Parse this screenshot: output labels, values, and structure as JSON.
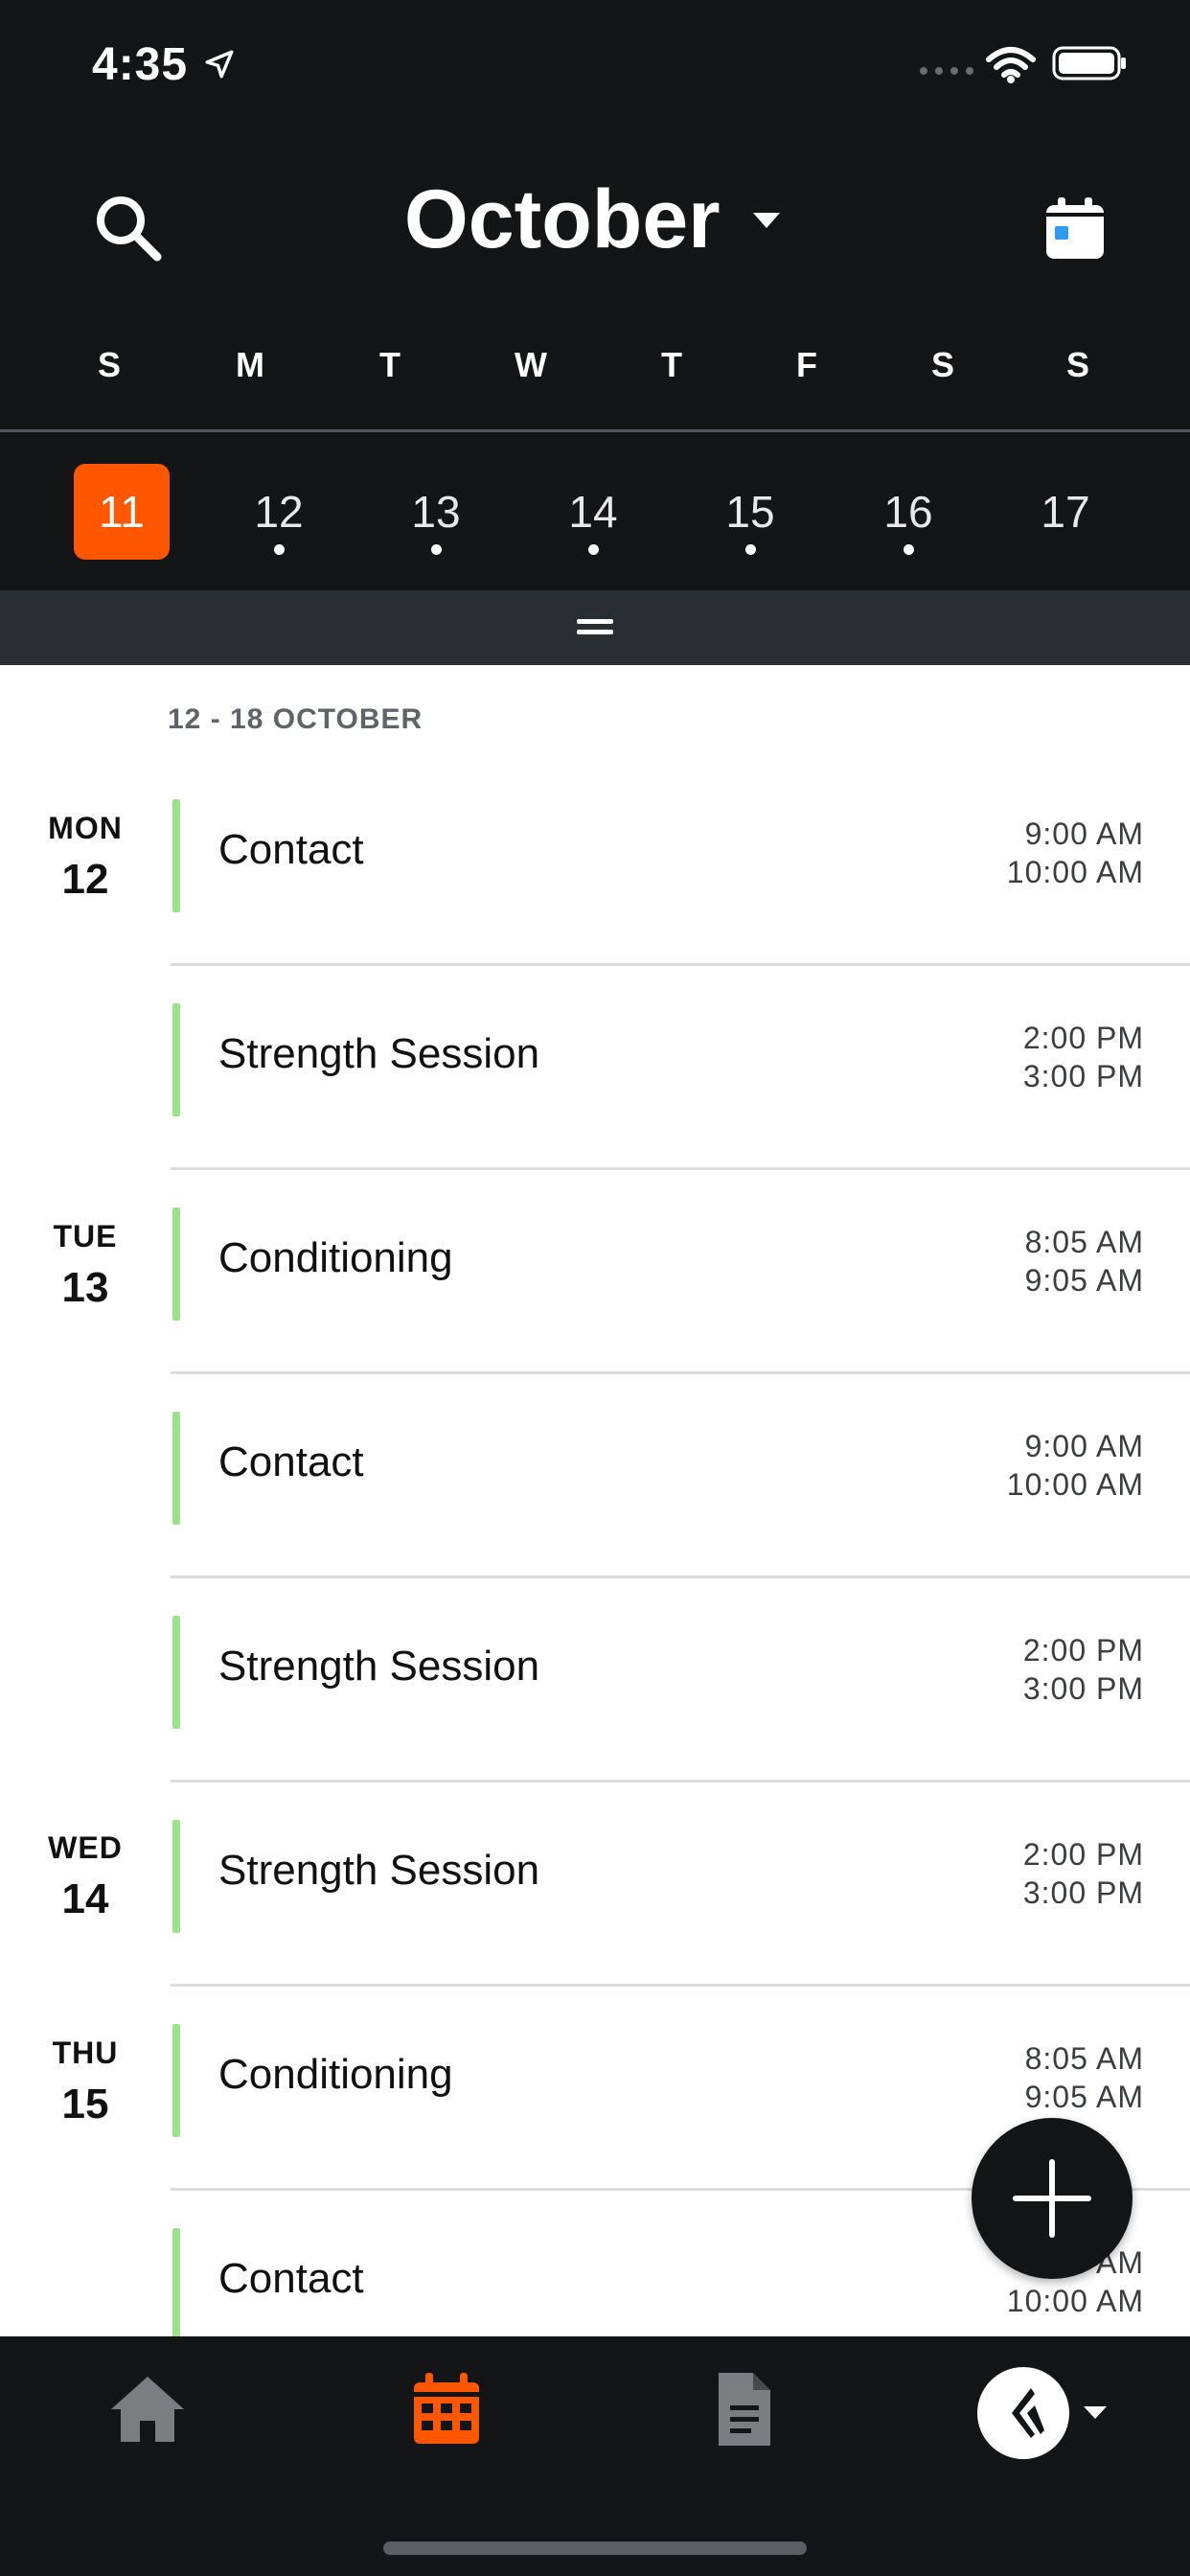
{
  "status_bar": {
    "time": "4:35"
  },
  "header": {
    "month": "October"
  },
  "weekdays": [
    "S",
    "M",
    "T",
    "W",
    "T",
    "F",
    "S",
    "S"
  ],
  "dates": [
    {
      "day": "11",
      "selected": true,
      "has_events": false
    },
    {
      "day": "12",
      "selected": false,
      "has_events": true
    },
    {
      "day": "13",
      "selected": false,
      "has_events": true
    },
    {
      "day": "14",
      "selected": false,
      "has_events": true
    },
    {
      "day": "15",
      "selected": false,
      "has_events": true
    },
    {
      "day": "16",
      "selected": false,
      "has_events": true
    },
    {
      "day": "17",
      "selected": false,
      "has_events": false
    }
  ],
  "agenda": {
    "week_range": "12 - 18 OCTOBER",
    "days": [
      {
        "name": "MON",
        "num": "12"
      },
      {
        "name": "TUE",
        "num": "13"
      },
      {
        "name": "WED",
        "num": "14"
      },
      {
        "name": "THU",
        "num": "15"
      }
    ],
    "events": [
      {
        "title": "Contact",
        "start": "9:00 AM",
        "end": "10:00 AM"
      },
      {
        "title": "Strength Session",
        "start": "2:00 PM",
        "end": "3:00 PM"
      },
      {
        "title": "Conditioning",
        "start": "8:05 AM",
        "end": "9:05 AM"
      },
      {
        "title": "Contact",
        "start": "9:00 AM",
        "end": "10:00 AM"
      },
      {
        "title": "Strength Session",
        "start": "2:00 PM",
        "end": "3:00 PM"
      },
      {
        "title": "Strength Session",
        "start": "2:00 PM",
        "end": "3:00 PM"
      },
      {
        "title": "Conditioning",
        "start": "8:05 AM",
        "end": "9:05 AM"
      },
      {
        "title": "Contact",
        "start": "9:00 AM",
        "end": "10:00 AM"
      }
    ]
  },
  "colors": {
    "accent": "#ff5600",
    "event_bar": "#9de28a",
    "background_dark": "#141517",
    "handle_band": "#2a2d31",
    "calendar_icon_dot": "#2f9bf0"
  },
  "icons": {
    "status": [
      "location-arrow-icon",
      "signal-icon",
      "wifi-icon",
      "battery-icon"
    ],
    "header": [
      "search-icon",
      "caret-down-icon",
      "calendar-icon"
    ],
    "tabs": [
      "home-icon",
      "calendar-icon",
      "document-icon",
      "avatar-logo-icon"
    ],
    "fab": "plus-icon"
  }
}
